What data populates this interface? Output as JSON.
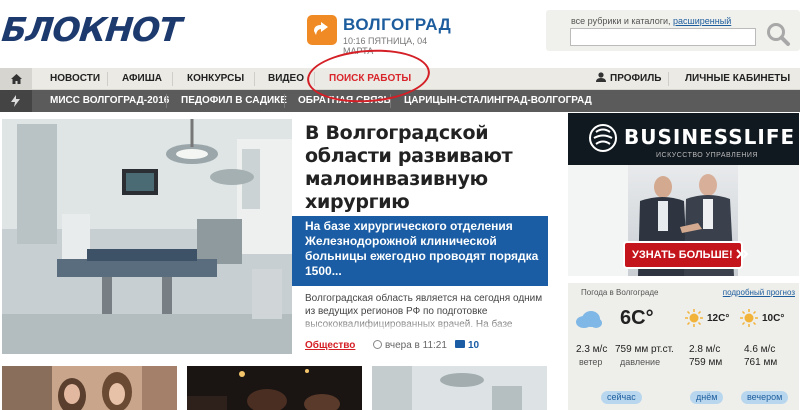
{
  "header": {
    "logo": "БЛОКНОТ",
    "city": "ВОЛГОГРАД",
    "datetime": "10:16 ПЯТНИЦА, 04 МАРТА",
    "search_caption": "все рубрики и каталоги,",
    "search_link": "расширенный",
    "search_value": ""
  },
  "nav": {
    "items": [
      "НОВОСТИ",
      "АФИША",
      "КОНКУРСЫ",
      "ВИДЕО",
      "ПОИСК РАБОТЫ"
    ],
    "profile": "ПРОФИЛЬ",
    "cabinets": "ЛИЧНЫЕ КАБИНЕТЫ"
  },
  "hot_topics": [
    "МИСС ВОЛГОГРАД-2016",
    "ПЕДОФИЛ В САДИКЕ",
    "ОБРАТНАЯ СВЯЗЬ",
    "ЦАРИЦЫН-СТАЛИНГРАД-ВОЛГОГРАД"
  ],
  "main_news": {
    "title": "В Волгоградской области развивают малоинвазивную хирургию",
    "lead": "На базе хирургического отделения Железнодорожной клинической больницы ежегодно проводят порядка 1500...",
    "summary": "Волгоградская область является на сегодня одним из ведущих регионов РФ по подготовке высококвалифицированных врачей. На базе",
    "rubric": "Общество",
    "time": "вчера в 11:21",
    "comments": "10"
  },
  "ad": {
    "brand": "BUSINESSLIFE",
    "tagline": "ИСКУССТВО УПРАВЛЕНИЯ",
    "cta": "УЗНАТЬ БОЛЬШЕ!"
  },
  "weather": {
    "title": "Погода в Волгограде",
    "more_link": "подробный прогноз",
    "now": {
      "temp": "6C°",
      "wind": "2.3 м/с",
      "wind_label": "ветер",
      "pressure": "759 мм рт.ст.",
      "pressure_label": "давление",
      "label": "сейчас"
    },
    "day": {
      "temp": "12C°",
      "wind": "2.8 м/с",
      "pressure": "759 мм",
      "label": "днём"
    },
    "evening": {
      "temp": "10C°",
      "wind": "4.6 м/с",
      "pressure": "761 мм",
      "label": "вечером"
    }
  },
  "colors": {
    "brand_blue": "#1d3a6e",
    "accent_red": "#d41f26",
    "lead_blue": "#1a5da4",
    "city_orange": "#f08a24"
  }
}
